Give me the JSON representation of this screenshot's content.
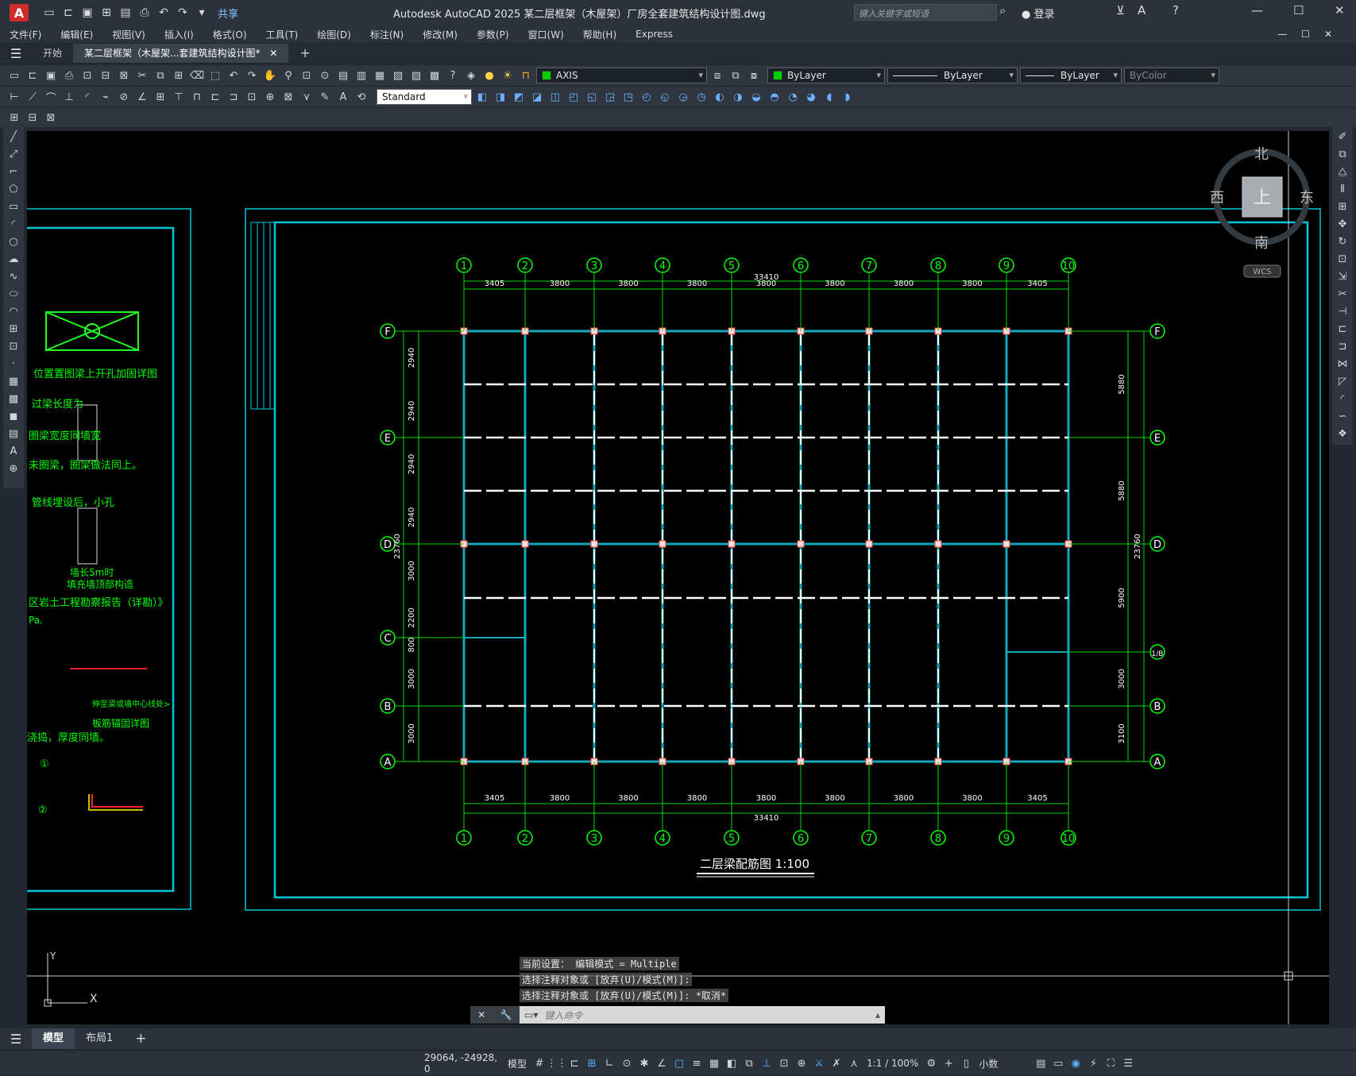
{
  "titlebar": {
    "app_logo": "A",
    "share_label": "共享",
    "title": "Autodesk AutoCAD 2025    某二层框架（木屋架）厂房全套建筑结构设计图.dwg",
    "search_placeholder": "键入关键字或短语",
    "login_label": "登录"
  },
  "menu": [
    "文件(F)",
    "编辑(E)",
    "视图(V)",
    "插入(I)",
    "格式(O)",
    "工具(T)",
    "绘图(D)",
    "标注(N)",
    "修改(M)",
    "参数(P)",
    "窗口(W)",
    "帮助(H)",
    "Express"
  ],
  "doc_tabs": {
    "start": "开始",
    "active": "某二层框架（木屋架...套建筑结构设计图*"
  },
  "toolbar": {
    "layer_combo": "AXIS",
    "color_combo": "ByLayer",
    "linetype_combo": "ByLayer",
    "lineweight_combo": "ByLayer",
    "plotstyle_combo": "ByColor",
    "textstyle_combo": "Standard"
  },
  "viewcube": {
    "north": "北",
    "south": "南",
    "east": "东",
    "west": "西",
    "top": "上",
    "wcs": "WCS"
  },
  "drawing": {
    "title": "二层梁配筋图  1:100",
    "axis_numbers": [
      "1",
      "2",
      "3",
      "4",
      "5",
      "6",
      "7",
      "8",
      "9",
      "10"
    ],
    "axis_letters": [
      "F",
      "E",
      "D",
      "C",
      "1/B",
      "B",
      "A"
    ],
    "top_total": "33410",
    "bottom_total": "33410",
    "spans": [
      "3405",
      "3800",
      "3800",
      "3800",
      "3800",
      "3800",
      "3800",
      "3800",
      "3405"
    ],
    "left_dims": [
      "2940",
      "2940",
      "2940",
      "2940",
      "3000",
      "2200",
      "800",
      "3000",
      "3000"
    ],
    "left_total": "23760",
    "right_dims": [
      "5880",
      "5880",
      "5900",
      "3000",
      "3100"
    ],
    "right_total": "23760",
    "left_notes": [
      "位置置图梁上开孔加固详图",
      "过梁长度为",
      "圈梁宽度同墙宽",
      "未圈梁，圈梁做法同上。",
      "管线埋设后，小孔",
      "墙长5m时",
      "填充墙顶部构造",
      "区岩土工程勘察报告（详勘）》",
      "Pa.",
      "伸至梁或墙中心线处>",
      "板筋锚固详图",
      "浇捣，厚度同墙。",
      "①",
      "②"
    ]
  },
  "command": {
    "history": [
      "当前设置： 编辑模式 = Multiple",
      "选择注释对象或 [放弃(U)/模式(M)]:",
      "选择注释对象或 [放弃(U)/模式(M)]: *取消*"
    ],
    "placeholder": "键入命令"
  },
  "layouts": {
    "model": "模型",
    "layout1": "布局1"
  },
  "status": {
    "coords": "29064, -24928, 0",
    "model": "模型",
    "scale": "1:1 / 100%",
    "units": "小数"
  }
}
